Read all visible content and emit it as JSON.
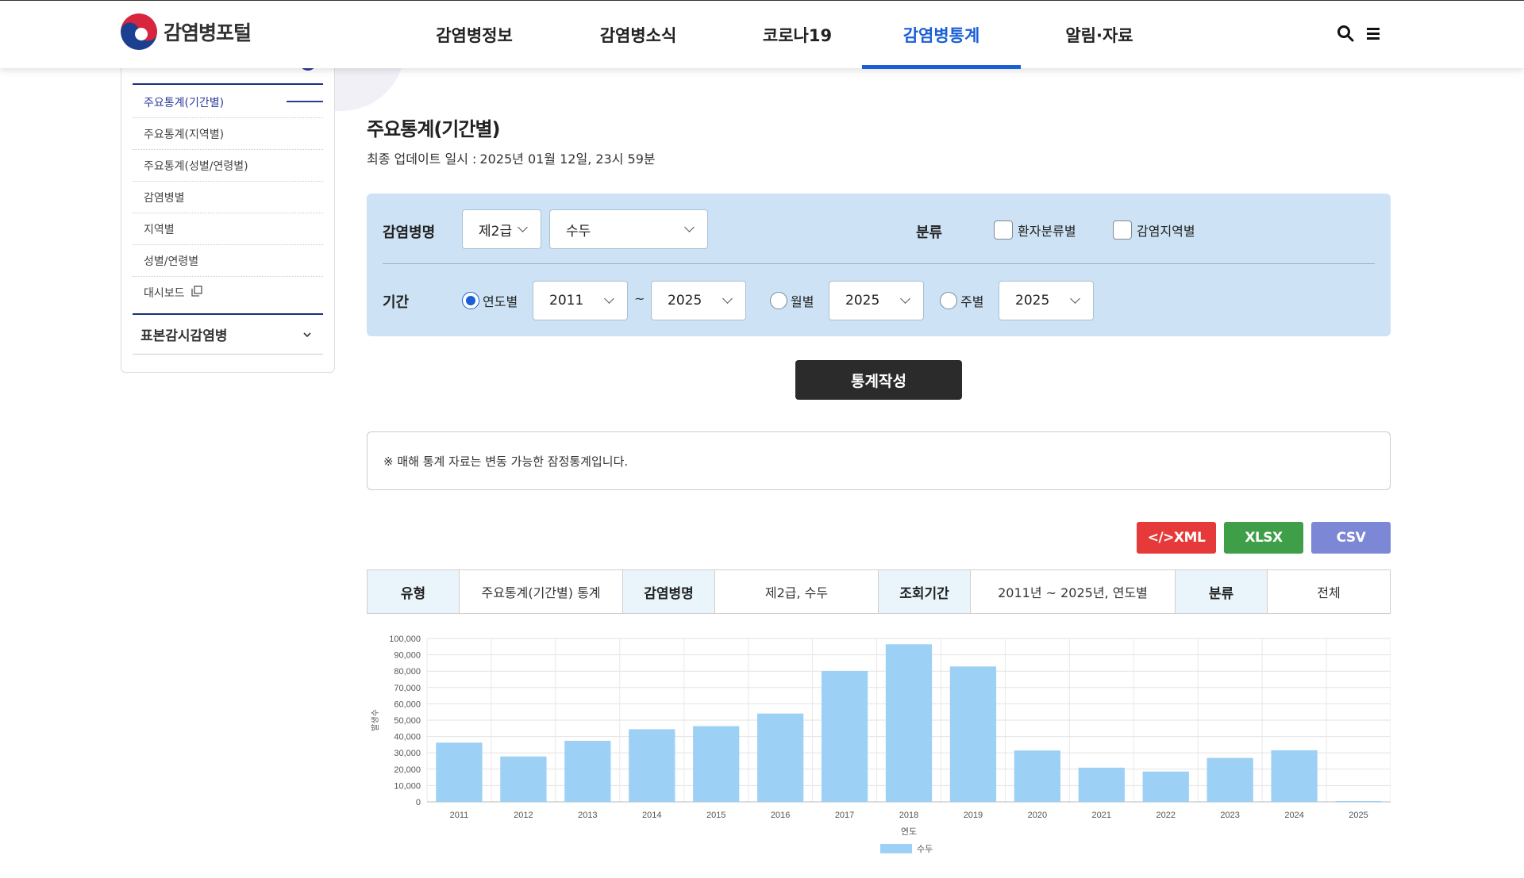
{
  "header": {
    "logo_text": "감염병포털",
    "nav": [
      {
        "label": "감염병정보"
      },
      {
        "label": "감염병소식"
      },
      {
        "label": "코로나19"
      },
      {
        "label": "감염병통계"
      },
      {
        "label": "알림·자료"
      }
    ],
    "active_nav": "감염병통계",
    "icons": [
      "search-icon",
      "menu-icon"
    ]
  },
  "sidebar": {
    "items": [
      {
        "label": "주요통계(기간별)",
        "active": true
      },
      {
        "label": "주요통계(지역별)"
      },
      {
        "label": "주요통계(성별/연령별)"
      },
      {
        "label": "감염병별"
      },
      {
        "label": "지역별"
      },
      {
        "label": "성별/연령별"
      },
      {
        "label": "대시보드"
      }
    ],
    "group_label": "표본감시감염병"
  },
  "page": {
    "title": "주요통계(기간별)",
    "update_label": "최종 업데이트 일시 :",
    "update_value": "2025년 01월 12일, 23시 59분"
  },
  "filter": {
    "disease_label": "감염병명",
    "grade_value": "제2급",
    "disease_value": "수두",
    "category_label": "분류",
    "check_patient": "환자분류별",
    "check_region": "감염지역별",
    "period_label": "기간",
    "radio_year": "연도별",
    "year_from": "2011",
    "tilde": "~",
    "year_to": "2025",
    "radio_month": "월별",
    "month_year": "2025",
    "radio_week": "주별",
    "week_year": "2025",
    "selected_period": "연도별"
  },
  "actions": {
    "submit_label": "통계작성",
    "xml_label": "</>XML",
    "xlsx_label": "XLSX",
    "csv_label": "CSV"
  },
  "notice": "※ 매해 통계 자료는 변동 가능한 잠정통계입니다.",
  "info_table": [
    {
      "head": "유형",
      "value": "주요통계(기간별) 통계"
    },
    {
      "head": "감염병명",
      "value": "제2급, 수두"
    },
    {
      "head": "조회기간",
      "value": "2011년 ~ 2025년, 연도별"
    },
    {
      "head": "분류",
      "value": "전체"
    }
  ],
  "colors": {
    "accent": "#1a5fd6",
    "filter_bg": "#cde3f5",
    "xml": "#e63a3a",
    "xlsx": "#3f9f48",
    "csv": "#7c87d6",
    "bar": "#9dd0f5"
  },
  "chart_data": {
    "type": "bar",
    "categories": [
      "2011",
      "2012",
      "2013",
      "2014",
      "2015",
      "2016",
      "2017",
      "2018",
      "2019",
      "2020",
      "2021",
      "2022",
      "2023",
      "2024",
      "2025"
    ],
    "series": [
      {
        "name": "수두",
        "values": [
          36249,
          27763,
          37361,
          44450,
          46330,
          54060,
          80092,
          96467,
          82868,
          31430,
          20929,
          18547,
          26904,
          31600,
          500
        ]
      }
    ],
    "xlabel": "연도",
    "ylabel": "발생수",
    "ylim": [
      0,
      100000
    ],
    "yticks": [
      0,
      10000,
      20000,
      30000,
      40000,
      50000,
      60000,
      70000,
      80000,
      90000,
      100000
    ],
    "ytick_labels": [
      "0",
      "10,000",
      "20,000",
      "30,000",
      "40,000",
      "50,000",
      "60,000",
      "70,000",
      "80,000",
      "90,000",
      "100,000"
    ],
    "grid": true,
    "legend": "bottom"
  }
}
